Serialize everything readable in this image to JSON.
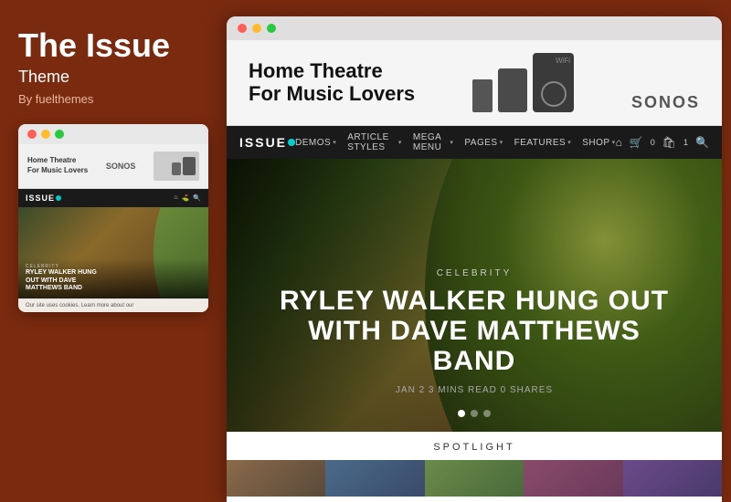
{
  "sidebar": {
    "title": "The Issue",
    "subtitle": "Theme",
    "by": "By fuelthemes",
    "mini_preview": {
      "titlebar_dots": [
        "red",
        "yellow",
        "green"
      ],
      "ad": {
        "headline": "Home Theatre\nFor Music Lovers",
        "brand": "SONOS"
      },
      "nav": {
        "logo": "ISSUE",
        "logo_dot": true
      },
      "hero": {
        "category": "CELEBRITY",
        "title": "RYLEY WALKER HUNG\nOUT WITH DAVE\nMATTHEWS BAND"
      },
      "cookie_text": "Our site uses cookies. Learn more about our"
    }
  },
  "browser": {
    "titlebar_dots": [
      "red",
      "yellow",
      "green"
    ]
  },
  "ad_banner": {
    "headline_line1": "Home Theatre",
    "headline_line2": "For Music Lovers",
    "brand": "SONOS"
  },
  "site_nav": {
    "logo": "ISSUE",
    "logo_dot_color": "#00d0d0",
    "links": [
      {
        "label": "DEMOS",
        "has_dropdown": true
      },
      {
        "label": "ARTICLE STYLES",
        "has_dropdown": true
      },
      {
        "label": "MEGA MENU",
        "has_dropdown": true
      },
      {
        "label": "PAGES",
        "has_dropdown": true
      },
      {
        "label": "FEATURES",
        "has_dropdown": true
      },
      {
        "label": "SHOP",
        "has_dropdown": true
      }
    ],
    "right_icons": [
      "home",
      "cart",
      "bag",
      "search"
    ],
    "cart_count": "0",
    "bag_count": "1"
  },
  "hero": {
    "category": "CELEBRITY",
    "title_line1": "RYLEY WALKER HUNG OUT",
    "title_line2": "WITH DAVE MATTHEWS BAND",
    "meta": "JAN 2   3 MINS READ   0 SHARES",
    "dots": [
      true,
      false,
      false
    ],
    "dot_active_index": 0
  },
  "spotlight": {
    "label": "SPOTLIGHT",
    "thumb_count": 5
  }
}
